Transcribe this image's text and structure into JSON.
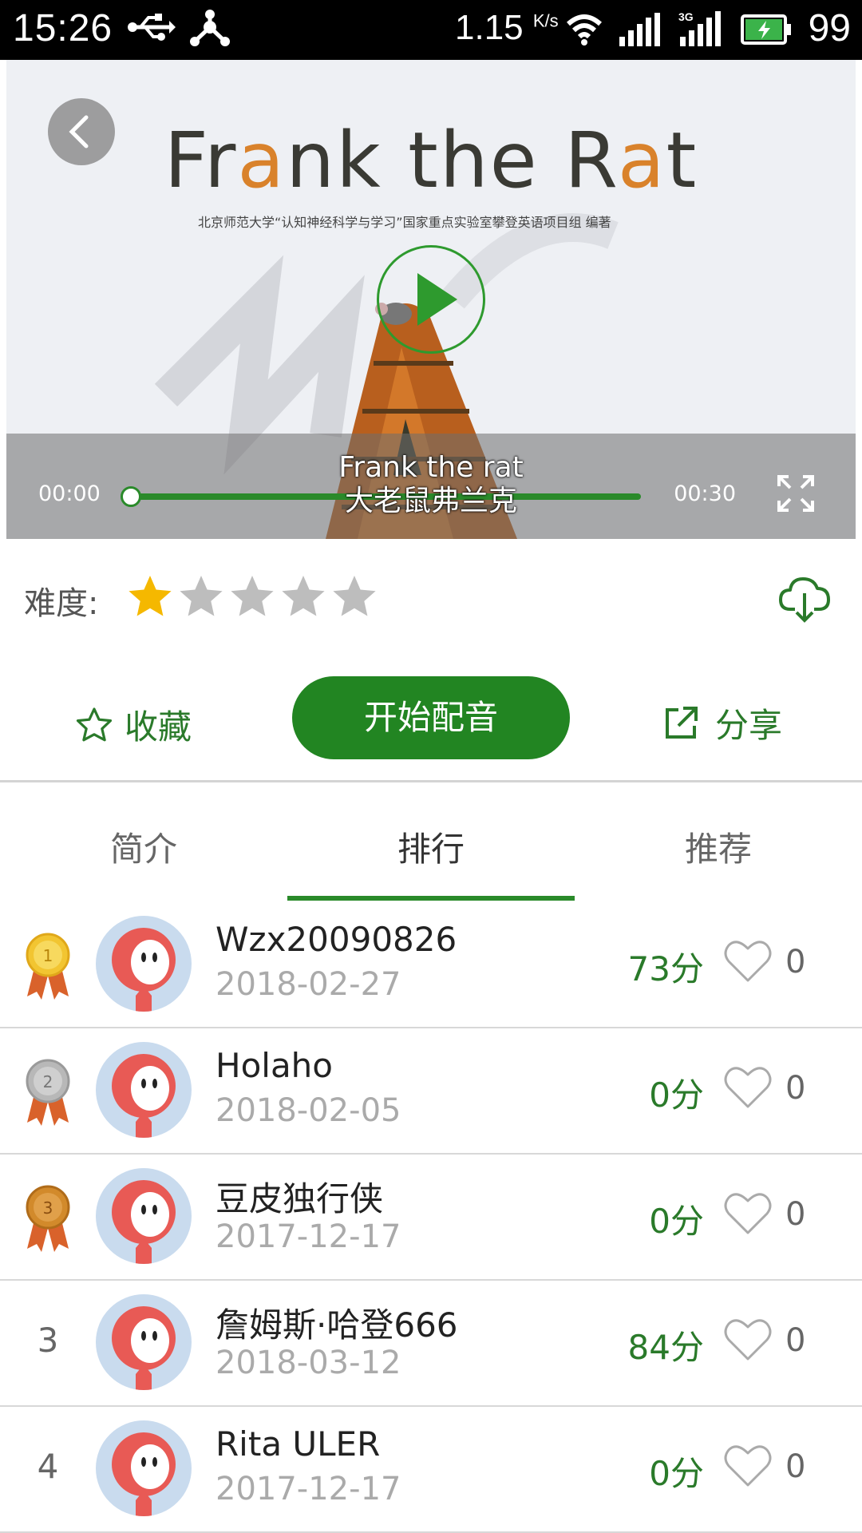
{
  "status_bar": {
    "time": "15:26",
    "net_speed": "1.15",
    "net_speed_unit": "K/s",
    "battery": "99",
    "icons": [
      "usb-icon",
      "share-network-icon",
      "wifi-icon",
      "signal-icon",
      "3g-signal-icon",
      "battery-charging-icon"
    ]
  },
  "video": {
    "title_parts": [
      "Fr",
      "a",
      "nk the R",
      "a",
      "t"
    ],
    "subtitle_cn": "北京师范大学“认知神经科学与学习”国家重点实验室攀登英语项目组 编著",
    "caption_en": "Frank the rat",
    "caption_cn": "大老鼠弗兰克",
    "time_current": "00:00",
    "time_total": "00:30",
    "progress": 0
  },
  "difficulty": {
    "label": "难度:",
    "rating": 1,
    "max": 5
  },
  "actions": {
    "favorite_label": "收藏",
    "start_label": "开始配音",
    "share_label": "分享"
  },
  "tabs": [
    {
      "label": "简介",
      "active": false
    },
    {
      "label": "排行",
      "active": true
    },
    {
      "label": "推荐",
      "active": false
    }
  ],
  "ranking": [
    {
      "rank": "1",
      "medal": "gold",
      "name": "Wzx20090826",
      "date": "2018-02-27",
      "score": "73分",
      "likes": "0"
    },
    {
      "rank": "2",
      "medal": "silver",
      "name": "Holaho",
      "date": "2018-02-05",
      "score": "0分",
      "likes": "0"
    },
    {
      "rank": "3",
      "medal": "bronze",
      "name": "豆皮独行侠",
      "date": "2017-12-17",
      "score": "0分",
      "likes": "0"
    },
    {
      "rank": "3",
      "medal": null,
      "name": "詹姆斯·哈登666",
      "date": "2018-03-12",
      "score": "84分",
      "likes": "0"
    },
    {
      "rank": "4",
      "medal": null,
      "name": "Rita ULER",
      "date": "2017-12-17",
      "score": "0分",
      "likes": "0"
    }
  ],
  "colors": {
    "accent": "#228522",
    "score": "#2a7a2a",
    "star_on": "#f5b800",
    "star_off": "#bdbdbd",
    "gold": "#f2c531",
    "silver": "#b8b8b8",
    "bronze": "#d28a2b"
  }
}
